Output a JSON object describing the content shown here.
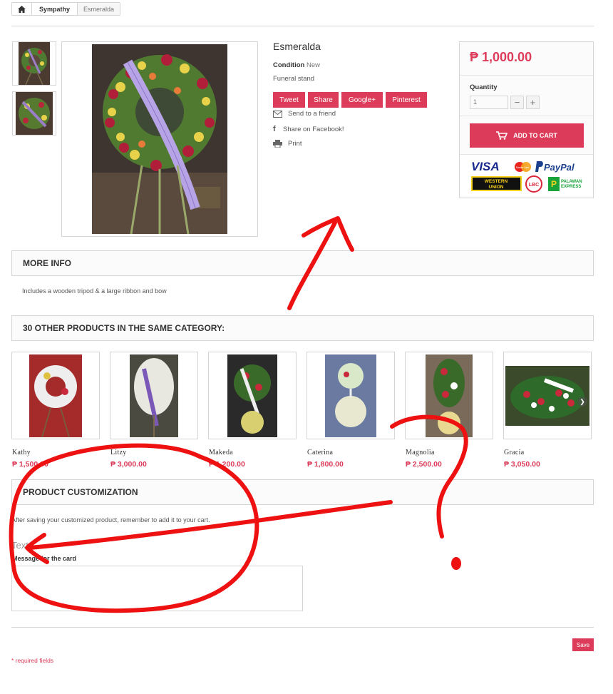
{
  "breadcrumb": {
    "home_icon": "home-icon",
    "category": "Sympathy",
    "current": "Esmeralda"
  },
  "product": {
    "name": "Esmeralda",
    "condition_label": "Condition",
    "condition_value": "New",
    "description": "Funeral stand",
    "share_buttons": [
      "Tweet",
      "Share",
      "Google+",
      "Pinterest"
    ],
    "send_friend": "Send to a friend",
    "share_facebook": "Share on Facebook!",
    "print": "Print"
  },
  "buy": {
    "price": "₱ 1,000.00",
    "quantity_label": "Quantity",
    "quantity_value": "1",
    "minus": "−",
    "plus": "+",
    "add_to_cart": "ADD TO CART",
    "payment_logos": [
      "VISA",
      "MasterCard",
      "PayPal",
      "Western Union",
      "LBC",
      "Palawan Express"
    ]
  },
  "more_info": {
    "title": "MORE INFO",
    "text": "Includes a wooden tripod & a large ribbon and bow"
  },
  "related": {
    "title": "30 OTHER PRODUCTS IN THE SAME CATEGORY:",
    "items": [
      {
        "name": "Kathy",
        "price": "₱ 1,500.00"
      },
      {
        "name": "Litzy",
        "price": "₱ 3,000.00"
      },
      {
        "name": "Makeda",
        "price": "₱ 1,200.00"
      },
      {
        "name": "Caterina",
        "price": "₱ 1,800.00"
      },
      {
        "name": "Magnolia",
        "price": "₱ 2,500.00"
      },
      {
        "name": "Gracia",
        "price": "₱ 3,050.00"
      }
    ]
  },
  "customization": {
    "title": "PRODUCT CUSTOMIZATION",
    "note": "After saving your customized product, remember to add it to your cart.",
    "section": "Text",
    "field_label": "Message for the card",
    "field_value": "",
    "save": "Save",
    "required": "* required fields"
  },
  "colors": {
    "accent": "#dc3c5a",
    "annotation": "#ee1111"
  }
}
